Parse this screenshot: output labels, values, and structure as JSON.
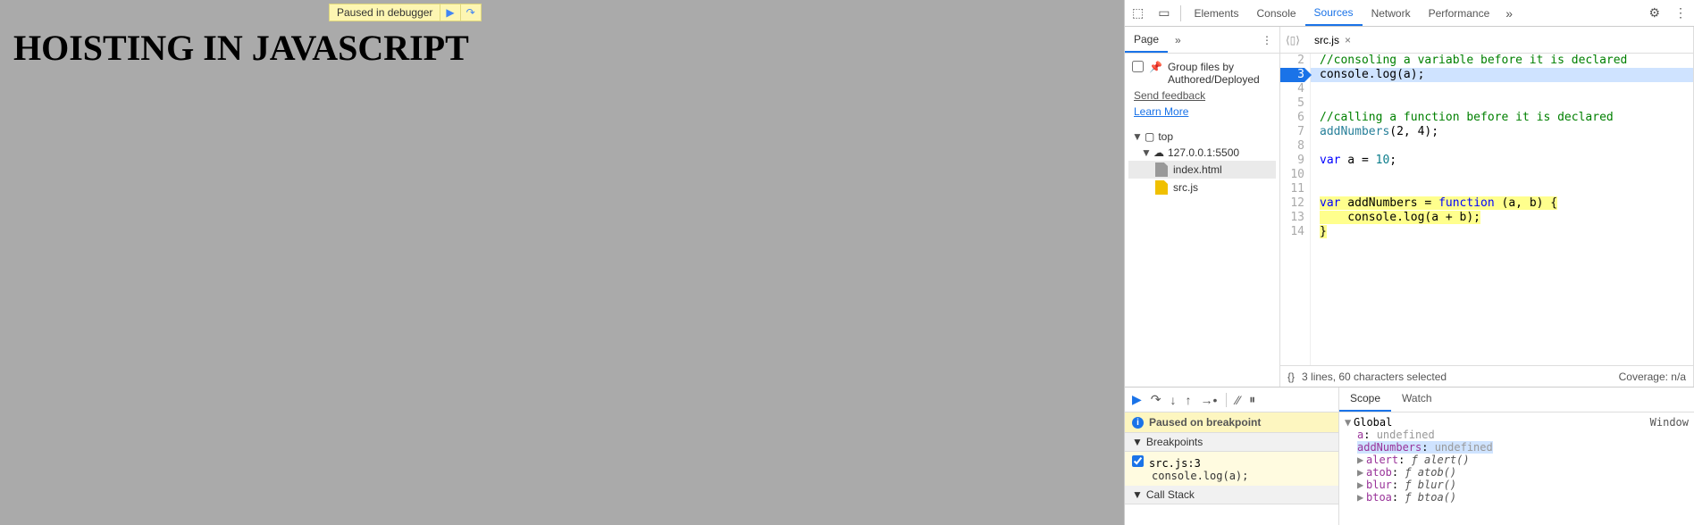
{
  "page": {
    "heading": "HOISTING IN JAVASCRIPT",
    "debug_badge": "Paused in debugger"
  },
  "toolbar": {
    "tabs": [
      "Elements",
      "Console",
      "Sources",
      "Network",
      "Performance"
    ],
    "active_tab": "Sources"
  },
  "navigator": {
    "tab": "Page",
    "group_label": "Group files by Authored/Deployed",
    "feedback": "Send feedback",
    "learn_more": "Learn More",
    "tree": {
      "top": "top",
      "host": "127.0.0.1:5500",
      "files": [
        "index.html",
        "src.js"
      ]
    }
  },
  "editor": {
    "file_tab": "src.js",
    "lines": {
      "l2": "//consoling a variable before it is declared",
      "l3": "console.log(a);",
      "l6": "//calling a function before it is declared",
      "l7a": "addNumbers",
      "l7b": "(2, 4);",
      "l9a": "var",
      "l9b": " a = ",
      "l9c": "10",
      "l9d": ";",
      "l12a": "var",
      "l12b": " addNumbers = ",
      "l12c": "function",
      "l12d": " (a, b) {",
      "l13": "    console.log(a + b);",
      "l14": "}"
    },
    "status_left": "3 lines, 60 characters selected",
    "status_right": "Coverage: n/a"
  },
  "debugger": {
    "paused_msg": "Paused on breakpoint",
    "panels": {
      "breakpoints": "Breakpoints",
      "call_stack": "Call Stack"
    },
    "breakpoint": {
      "loc": "src.js:3",
      "code": "console.log(a);"
    }
  },
  "scope": {
    "tabs": [
      "Scope",
      "Watch"
    ],
    "global": "Global",
    "window": "Window",
    "vars": {
      "a_name": "a",
      "a_val": "undefined",
      "addNumbers_name": "addNumbers",
      "addNumbers_val": "undefined",
      "alert_name": "alert",
      "alert_val": "ƒ alert()",
      "atob_name": "atob",
      "atob_val": "ƒ atob()",
      "blur_name": "blur",
      "blur_val": "ƒ blur()",
      "btoa_name": "btoa",
      "btoa_val": "ƒ btoa()"
    }
  }
}
